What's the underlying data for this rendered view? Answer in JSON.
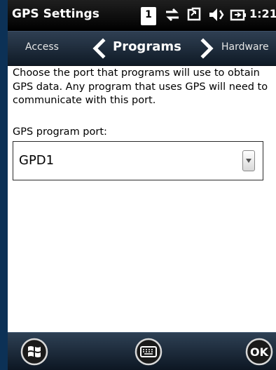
{
  "window": {
    "title": "GPS Settings",
    "time": "1:21",
    "notification_count": "1",
    "status_icons": [
      "connectivity-icon",
      "sync-icon",
      "volume-icon",
      "battery-icon"
    ]
  },
  "tabs": {
    "previous": "Access",
    "current": "Programs",
    "next": "Hardware"
  },
  "content": {
    "description": "Choose the port that programs will use to obtain GPS data. Any program that uses GPS will need to communicate with this port.",
    "port_label": "GPS program port:",
    "port_value": "GPD1"
  },
  "bottom_bar": {
    "ok_label": "OK",
    "icons": [
      "windows-start-icon",
      "keyboard-icon",
      "ok-icon"
    ]
  }
}
